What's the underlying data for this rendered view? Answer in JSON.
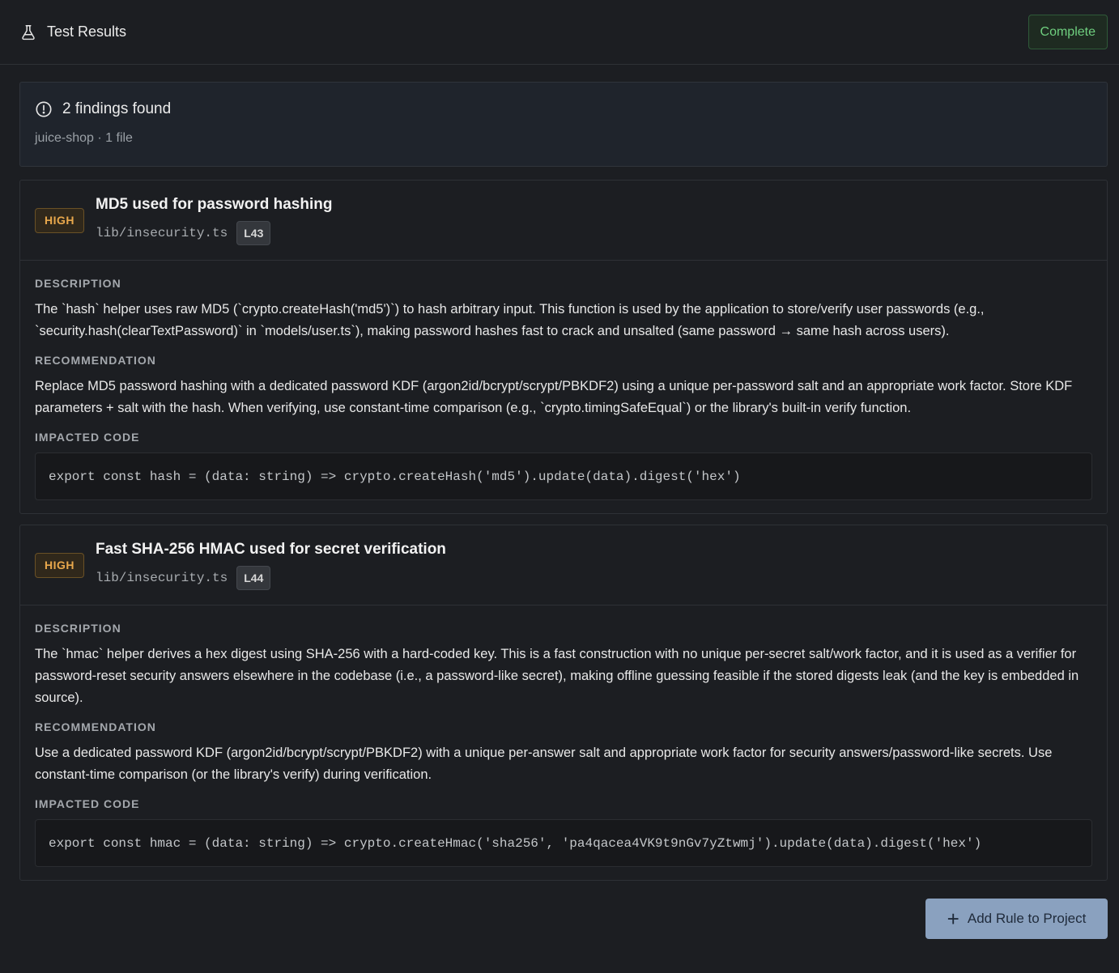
{
  "header": {
    "title": "Test Results",
    "icon": "flask-icon",
    "status": "Complete"
  },
  "summary": {
    "icon": "alert-circle-icon",
    "title": "2 findings found",
    "subtitle": "juice-shop · 1 file"
  },
  "findings": [
    {
      "severity": "HIGH",
      "title": "MD5 used for password hashing",
      "file": "lib/insecurity.ts",
      "line": "L43",
      "description_label": "DESCRIPTION",
      "description": "The `hash` helper uses raw MD5 (`crypto.createHash('md5')`) to hash arbitrary input. This function is used by the application to store/verify user passwords (e.g., `security.hash(clearTextPassword)` in `models/user.ts`), making password hashes fast to crack and unsalted (same password → same hash across users).",
      "recommendation_label": "RECOMMENDATION",
      "recommendation": "Replace MD5 password hashing with a dedicated password KDF (argon2id/bcrypt/scrypt/PBKDF2) using a unique per-password salt and an appropriate work factor. Store KDF parameters + salt with the hash. When verifying, use constant-time comparison (e.g., `crypto.timingSafeEqual`) or the library's built-in verify function.",
      "code_label": "IMPACTED CODE",
      "code": "export const hash = (data: string) => crypto.createHash('md5').update(data).digest('hex')"
    },
    {
      "severity": "HIGH",
      "title": "Fast SHA-256 HMAC used for secret verification",
      "file": "lib/insecurity.ts",
      "line": "L44",
      "description_label": "DESCRIPTION",
      "description": "The `hmac` helper derives a hex digest using SHA-256 with a hard-coded key. This is a fast construction with no unique per-secret salt/work factor, and it is used as a verifier for password-reset security answers elsewhere in the codebase (i.e., a password-like secret), making offline guessing feasible if the stored digests leak (and the key is embedded in source).",
      "recommendation_label": "RECOMMENDATION",
      "recommendation": "Use a dedicated password KDF (argon2id/bcrypt/scrypt/PBKDF2) with a unique per-answer salt and appropriate work factor for security answers/password-like secrets. Use constant-time comparison (or the library's verify) during verification.",
      "code_label": "IMPACTED CODE",
      "code": "export const hmac = (data: string) => crypto.createHmac('sha256', 'pa4qacea4VK9t9nGv7yZtwmj').update(data).digest('hex')"
    }
  ],
  "footer": {
    "add_rule_label": "Add Rule to Project",
    "add_rule_icon": "plus-icon"
  },
  "colors": {
    "background": "#1c1e22",
    "status_complete": "#6fcf7f",
    "severity_high": "#e9a84c",
    "primary_button": "#8aa1bf"
  }
}
